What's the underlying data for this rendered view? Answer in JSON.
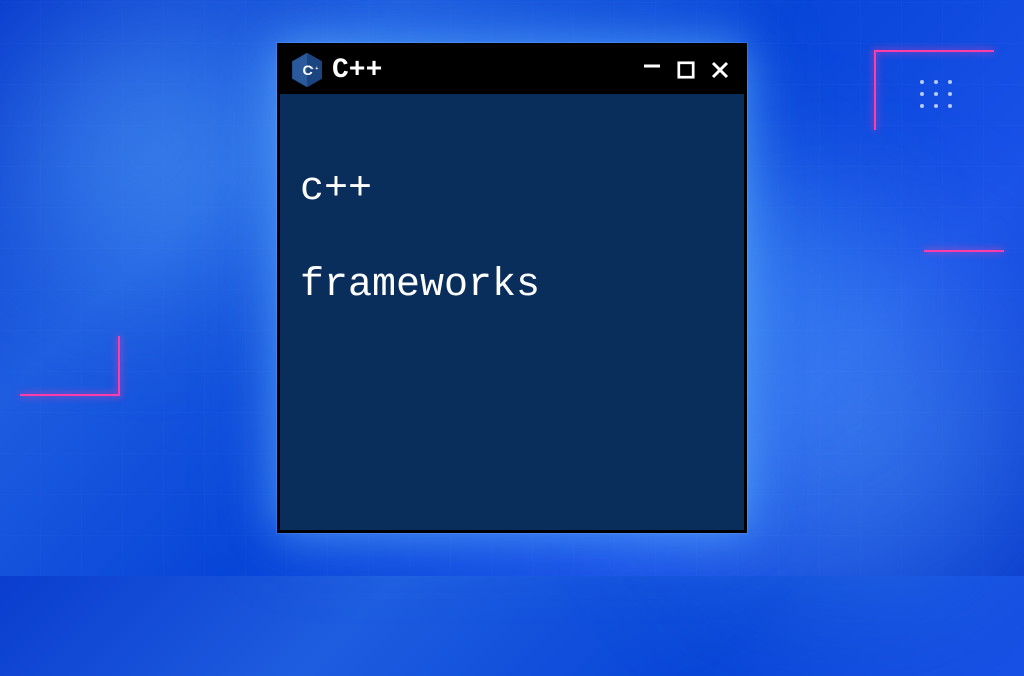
{
  "window": {
    "title": "C++",
    "icon_name": "cpp-hexagon-icon"
  },
  "terminal": {
    "line1": "c++",
    "line2": "frameworks"
  },
  "colors": {
    "terminal_bg": "#0a2e5c",
    "titlebar_bg": "#000000",
    "text": "#ffffff",
    "neon_accent": "#ff3da8",
    "bg_primary": "#0a3dce"
  }
}
